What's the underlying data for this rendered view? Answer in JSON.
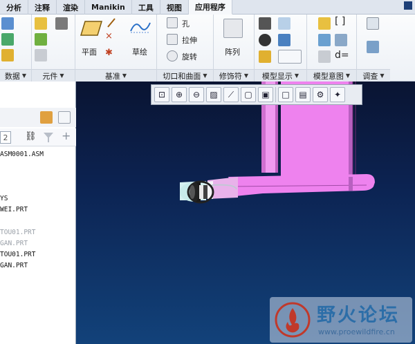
{
  "tabs": [
    "分析",
    "注释",
    "渲染",
    "Manikin",
    "工具",
    "视图",
    "应用程序"
  ],
  "ribbon": {
    "groups": {
      "data": "数据",
      "component": "元件",
      "datum": "基准",
      "cut_surface": "切口和曲面",
      "modifiers": "修饰符",
      "model_display": "模型显示",
      "model_intent": "模型意图",
      "investigate": "调查"
    },
    "datum_plane": "平面",
    "sketch": "草绘",
    "hole": "孔",
    "extrude": "拉伸",
    "revolve": "旋转",
    "pattern": "阵列"
  },
  "tree": {
    "number_field": "2",
    "items": [
      {
        "text": "ASM0001.ASM",
        "dim": false
      },
      {
        "text": "YS",
        "dim": false
      },
      {
        "text": "WEI.PRT",
        "dim": false
      },
      {
        "text": "TOU01.PRT",
        "dim": true
      },
      {
        "text": "GAN.PRT",
        "dim": true
      },
      {
        "text": "TOU01.PRT",
        "dim": false
      },
      {
        "text": "GAN.PRT",
        "dim": false
      }
    ]
  },
  "watermark": {
    "title": "野火论坛",
    "url": "www.proewildfire.cn"
  },
  "colors": {
    "model_pink": "#ee82ee",
    "viewport_top": "#0a1432",
    "viewport_bottom": "#12427a",
    "watermark_red": "#c0392b"
  }
}
